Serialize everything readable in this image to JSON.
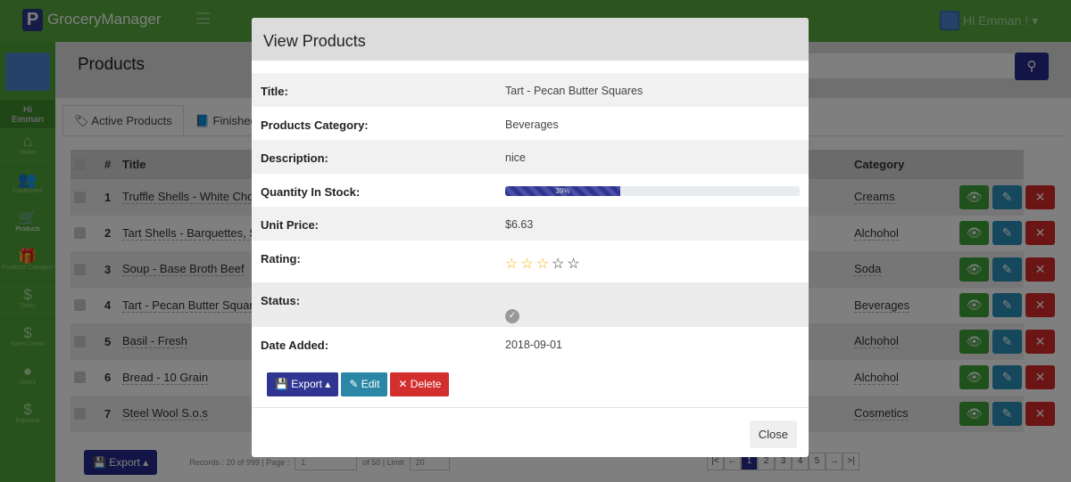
{
  "app": {
    "logo": "P",
    "brand": "GroceryManager",
    "greeting": "Hi Emman !"
  },
  "sidebar": {
    "hi": "Hi",
    "name": "Emman",
    "items": [
      {
        "label": "Home",
        "icon": "⌂"
      },
      {
        "label": "Customers",
        "icon": "👥"
      },
      {
        "label": "Products",
        "icon": "🛒"
      },
      {
        "label": "Products Category",
        "icon": "🎁"
      },
      {
        "label": "Sales",
        "icon": "$"
      },
      {
        "label": "Sales Detail",
        "icon": "$"
      },
      {
        "label": "Users",
        "icon": "●"
      },
      {
        "label": "Expense",
        "icon": "$"
      }
    ]
  },
  "page": {
    "title": "Products",
    "tabs": [
      {
        "label": "Active Products",
        "icon": "tag-icon"
      },
      {
        "label": "Finished",
        "icon": "book-icon"
      }
    ]
  },
  "table": {
    "headers": {
      "num": "#",
      "title": "Title",
      "category": "Category"
    },
    "rows": [
      {
        "num": "1",
        "title": "Truffle Shells - White Choc",
        "category": "Creams"
      },
      {
        "num": "2",
        "title": "Tart Shells - Barquettes, Sa",
        "category": "Alchohol"
      },
      {
        "num": "3",
        "title": "Soup - Base Broth Beef",
        "category": "Soda"
      },
      {
        "num": "4",
        "title": "Tart - Pecan Butter Squares",
        "category": "Beverages"
      },
      {
        "num": "5",
        "title": "Basil - Fresh",
        "category": "Alchohol"
      },
      {
        "num": "6",
        "title": "Bread - 10 Grain",
        "category": "Alchohol"
      },
      {
        "num": "7",
        "title": "Steel Wool S.o.s",
        "category": "Cosmetics"
      }
    ]
  },
  "footer": {
    "export": "Export",
    "records": "Records : 20 of 999 | Page :",
    "page": "1",
    "of": "of 50 | Limit",
    "limit": "20",
    "pages": [
      "|<",
      "←",
      "1",
      "2",
      "3",
      "4",
      "5",
      "→",
      ">|"
    ]
  },
  "modal": {
    "title": "View Products",
    "fields": {
      "title_label": "Title:",
      "title": "Tart - Pecan Butter Squares",
      "category_label": "Products Category:",
      "category": "Beverages",
      "description_label": "Description:",
      "description": "nice",
      "qty_label": "Quantity In Stock:",
      "qty_percent": 39,
      "qty_text": "39%",
      "price_label": "Unit Price:",
      "price": "$6.63",
      "rating_label": "Rating:",
      "rating": 3,
      "rating_max": 5,
      "status_label": "Status:",
      "status": "active",
      "date_label": "Date Added:",
      "date": "2018-09-01"
    },
    "buttons": {
      "export": "Export",
      "edit": "Edit",
      "delete": "Delete",
      "close": "Close"
    }
  },
  "colors": {
    "header": "#57a83f",
    "primary": "#242a8c",
    "view": "#3ea33a",
    "edit": "#2a8fba",
    "delete": "#d92a2a",
    "star": "#f5b400"
  }
}
